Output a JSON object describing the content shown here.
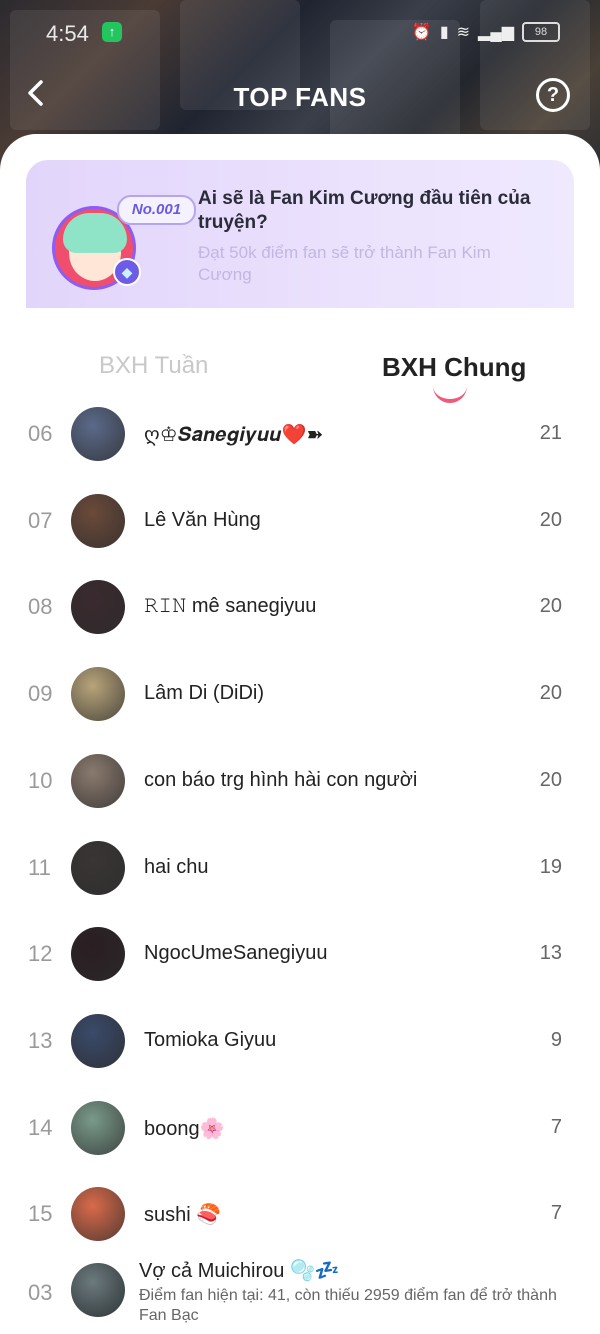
{
  "status_bar": {
    "time": "4:54",
    "battery": "98"
  },
  "header": {
    "title": "TOP FANS"
  },
  "banner": {
    "badge": "No.001",
    "title": "Ai sẽ là Fan Kim Cương đầu tiên của truyện?",
    "subtitle": "Đạt 50k điểm fan sẽ trở thành Fan Kim Cương"
  },
  "tabs": [
    {
      "label": "BXH Tuần",
      "active": false
    },
    {
      "label": "BXH Chung",
      "active": true
    }
  ],
  "leaderboard": [
    {
      "rank": "06",
      "name": "ღ♔𝑺𝒂𝒏𝒆𝒈𝒊𝒚𝒖𝒖❤️➽",
      "score": "21",
      "color": "#5b6a8a"
    },
    {
      "rank": "07",
      "name": "Lê Văn Hùng",
      "score": "20",
      "color": "#6b4a3a"
    },
    {
      "rank": "08",
      "name": "𝚁𝙸𝙽 mê sanegiyuu",
      "score": "20",
      "color": "#3a2a2e"
    },
    {
      "rank": "09",
      "name": "Lâm Di (DiDi)",
      "score": "20",
      "color": "#b8a47a"
    },
    {
      "rank": "10",
      "name": "con báo trg hình hài con người",
      "score": "20",
      "color": "#8a7a6e"
    },
    {
      "rank": "11",
      "name": "hai chu",
      "score": "19",
      "color": "#3a3535"
    },
    {
      "rank": "12",
      "name": "NgocUmeSanegiyuu",
      "score": "13",
      "color": "#2a1e22"
    },
    {
      "rank": "13",
      "name": "Tomioka Giyuu",
      "score": "9",
      "color": "#3a4a6a"
    },
    {
      "rank": "14",
      "name": "boong🌸",
      "score": "7",
      "color": "#7a9a8a"
    },
    {
      "rank": "15",
      "name": "sushi 🍣",
      "score": "7",
      "color": "#d96a4a"
    }
  ],
  "current_user": {
    "rank": "03",
    "name": "Vợ cả Muichirou 🫧💤",
    "progress_text": "Điểm fan hiện tại: 41, còn thiếu 2959 điểm fan để trở thành Fan Bạc"
  }
}
